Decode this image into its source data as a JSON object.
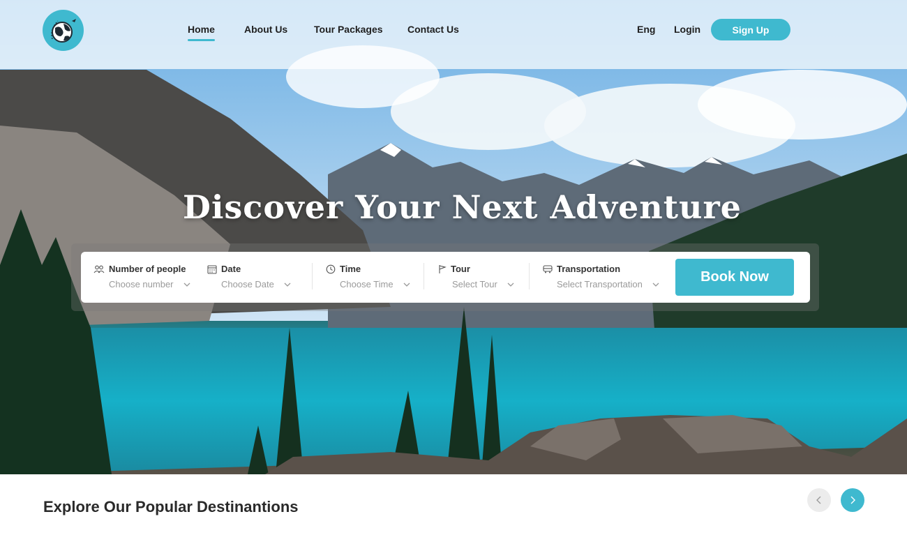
{
  "colors": {
    "accent": "#3fb9cf",
    "title": "#2a2a2a",
    "muted": "#9a9a9a"
  },
  "logo": {
    "icon": "globe-plane-icon"
  },
  "nav": {
    "items": [
      {
        "label": "Home",
        "active": true
      },
      {
        "label": "About Us"
      },
      {
        "label": "Tour Packages"
      },
      {
        "label": "Contact Us"
      }
    ],
    "language": "Eng",
    "login": "Login",
    "signup": "Sign Up"
  },
  "hero": {
    "headline": "Discover Your Next Adventure"
  },
  "booking": {
    "fields": [
      {
        "icon": "people-icon",
        "label": "Number of people",
        "placeholder": "Choose number"
      },
      {
        "icon": "calendar-icon",
        "label": "Date",
        "placeholder": "Choose Date"
      },
      {
        "icon": "clock-icon",
        "label": "Time",
        "placeholder": "Choose Time"
      },
      {
        "icon": "flag-icon",
        "label": "Tour",
        "placeholder": "Select Tour"
      },
      {
        "icon": "bus-icon",
        "label": "Transportation",
        "placeholder": "Select Transportation"
      }
    ],
    "button": "Book Now"
  },
  "destinations": {
    "title": "Explore Our Popular Destinantions",
    "prev_icon": "chevron-left-icon",
    "next_icon": "chevron-right-icon"
  }
}
